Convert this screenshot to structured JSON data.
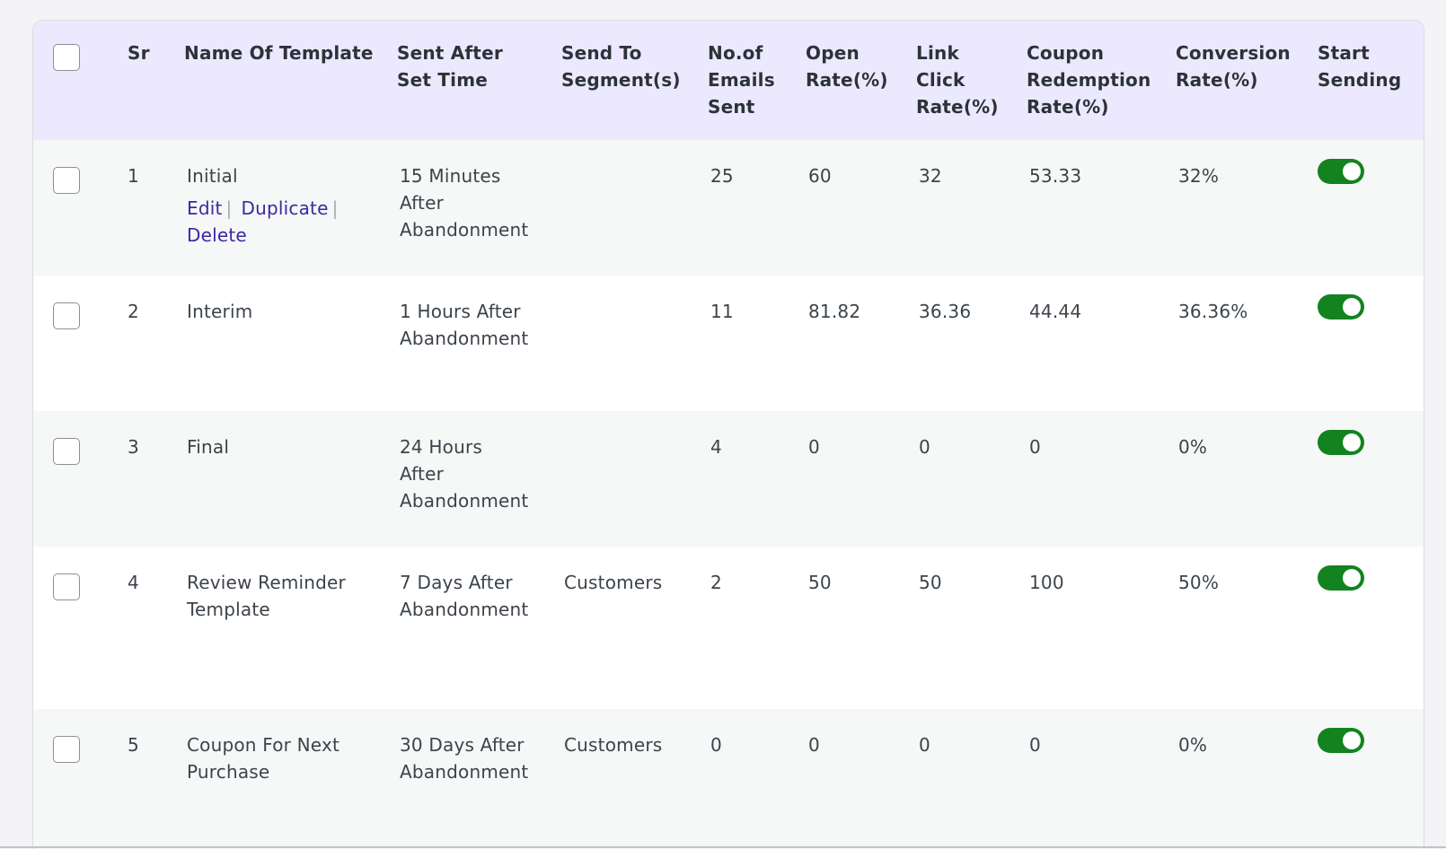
{
  "headers": {
    "sr": "Sr",
    "name": "Name Of Template",
    "sent_after": [
      "Sent After",
      "Set Time"
    ],
    "segment": [
      "Send To",
      "Segment(s)"
    ],
    "emails_sent": [
      "No.of",
      "Emails",
      "Sent"
    ],
    "open_rate": [
      "Open",
      "Rate(%)"
    ],
    "link_click": [
      "Link",
      "Click",
      "Rate(%)"
    ],
    "coupon": [
      "Coupon",
      "Redemption",
      "Rate(%)"
    ],
    "conversion": [
      "Conversion",
      "Rate(%)"
    ],
    "start": [
      "Start",
      "Sending"
    ]
  },
  "row_actions": {
    "edit": "Edit",
    "duplicate": "Duplicate",
    "delete": "Delete"
  },
  "rows": [
    {
      "sr": "1",
      "name": [
        "Initial"
      ],
      "sent_after": [
        "15 Minutes",
        "After",
        "Abandonment"
      ],
      "segment": "",
      "emails_sent": "25",
      "open_rate": "60",
      "link_click": "32",
      "coupon": "53.33",
      "conversion": "32%",
      "enabled": true
    },
    {
      "sr": "2",
      "name": [
        "Interim"
      ],
      "sent_after": [
        "1 Hours After",
        "Abandonment"
      ],
      "segment": "",
      "emails_sent": "11",
      "open_rate": "81.82",
      "link_click": "36.36",
      "coupon": "44.44",
      "conversion": "36.36%",
      "enabled": true
    },
    {
      "sr": "3",
      "name": [
        "Final"
      ],
      "sent_after": [
        "24 Hours",
        "After",
        "Abandonment"
      ],
      "segment": "",
      "emails_sent": "4",
      "open_rate": "0",
      "link_click": "0",
      "coupon": "0",
      "conversion": "0%",
      "enabled": true
    },
    {
      "sr": "4",
      "name": [
        "Review Reminder",
        "Template"
      ],
      "sent_after": [
        "7 Days After",
        "Abandonment"
      ],
      "segment": "Customers",
      "emails_sent": "2",
      "open_rate": "50",
      "link_click": "50",
      "coupon": "100",
      "conversion": "50%",
      "enabled": true
    },
    {
      "sr": "5",
      "name": [
        "Coupon For Next",
        "Purchase"
      ],
      "sent_after": [
        "30 Days After",
        "Abandonment"
      ],
      "segment": "Customers",
      "emails_sent": "0",
      "open_rate": "0",
      "link_click": "0",
      "coupon": "0",
      "conversion": "0%",
      "enabled": true
    }
  ],
  "colors": {
    "header_bg": "#ece9ff",
    "toggle_on": "#12831f",
    "link": "#3a2a9e"
  }
}
